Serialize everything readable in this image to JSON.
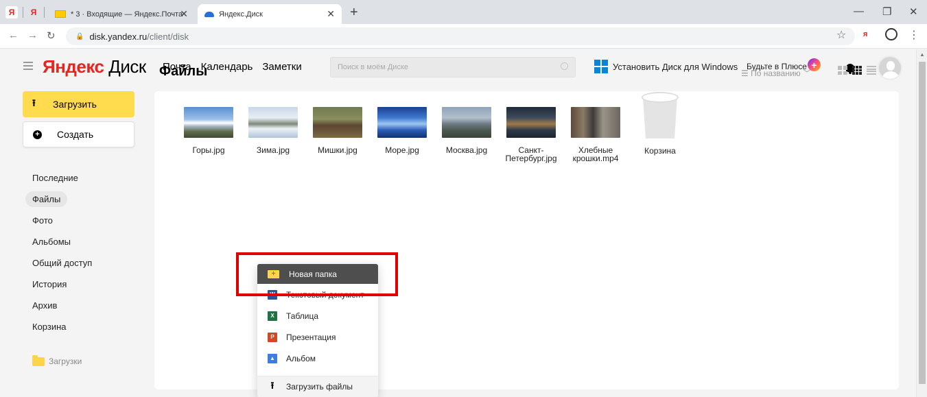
{
  "browser": {
    "mini_tabs": [
      "Я",
      "Я"
    ],
    "tabs": [
      {
        "label": "* 3 · Входящие — Яндекс.Почта"
      },
      {
        "label": "Яндекс.Диск"
      }
    ],
    "url_host": "disk.yandex.ru",
    "url_path": "/client/disk"
  },
  "header": {
    "logo_ya": "Яндекс",
    "logo_disk": "Диск",
    "nav": [
      "Почта",
      "Календарь",
      "Заметки"
    ],
    "search_placeholder": "Поиск в моём Диске",
    "install_label": "Установить Диск для Windows",
    "plus_label": "Будьте в Плюсе"
  },
  "sidebar": {
    "upload_label": "Загрузить",
    "create_label": "Создать",
    "items": [
      "Последние",
      "Файлы",
      "Фото",
      "Альбомы",
      "Общий доступ",
      "История",
      "Архив",
      "Корзина"
    ],
    "active": "Файлы",
    "downloads_label": "Загрузки"
  },
  "main": {
    "title": "Файлы",
    "sort_label": "По названию",
    "files": [
      {
        "name": "Горы.jpg"
      },
      {
        "name": "Зима.jpg"
      },
      {
        "name": "Мишки.jpg"
      },
      {
        "name": "Море.jpg"
      },
      {
        "name": "Москва.jpg"
      },
      {
        "name": "Санкт-Петербург.jpg"
      },
      {
        "name": "Хлебные крошки.mp4"
      },
      {
        "name": "Корзина"
      }
    ]
  },
  "context_menu": {
    "items": [
      {
        "label": "Новая папка",
        "icon": "folder-icon"
      },
      {
        "label": "Текстовый документ",
        "icon": "word-icon"
      },
      {
        "label": "Таблица",
        "icon": "excel-icon"
      },
      {
        "label": "Презентация",
        "icon": "powerpoint-icon"
      },
      {
        "label": "Альбом",
        "icon": "album-icon"
      },
      {
        "label": "Загрузить файлы",
        "icon": "upload-icon"
      }
    ]
  },
  "colors": {
    "yandex_red": "#e52620",
    "upload_yellow": "#ffdb4d",
    "highlight_dark": "#4e4e4e",
    "callout_red": "#e00000"
  }
}
